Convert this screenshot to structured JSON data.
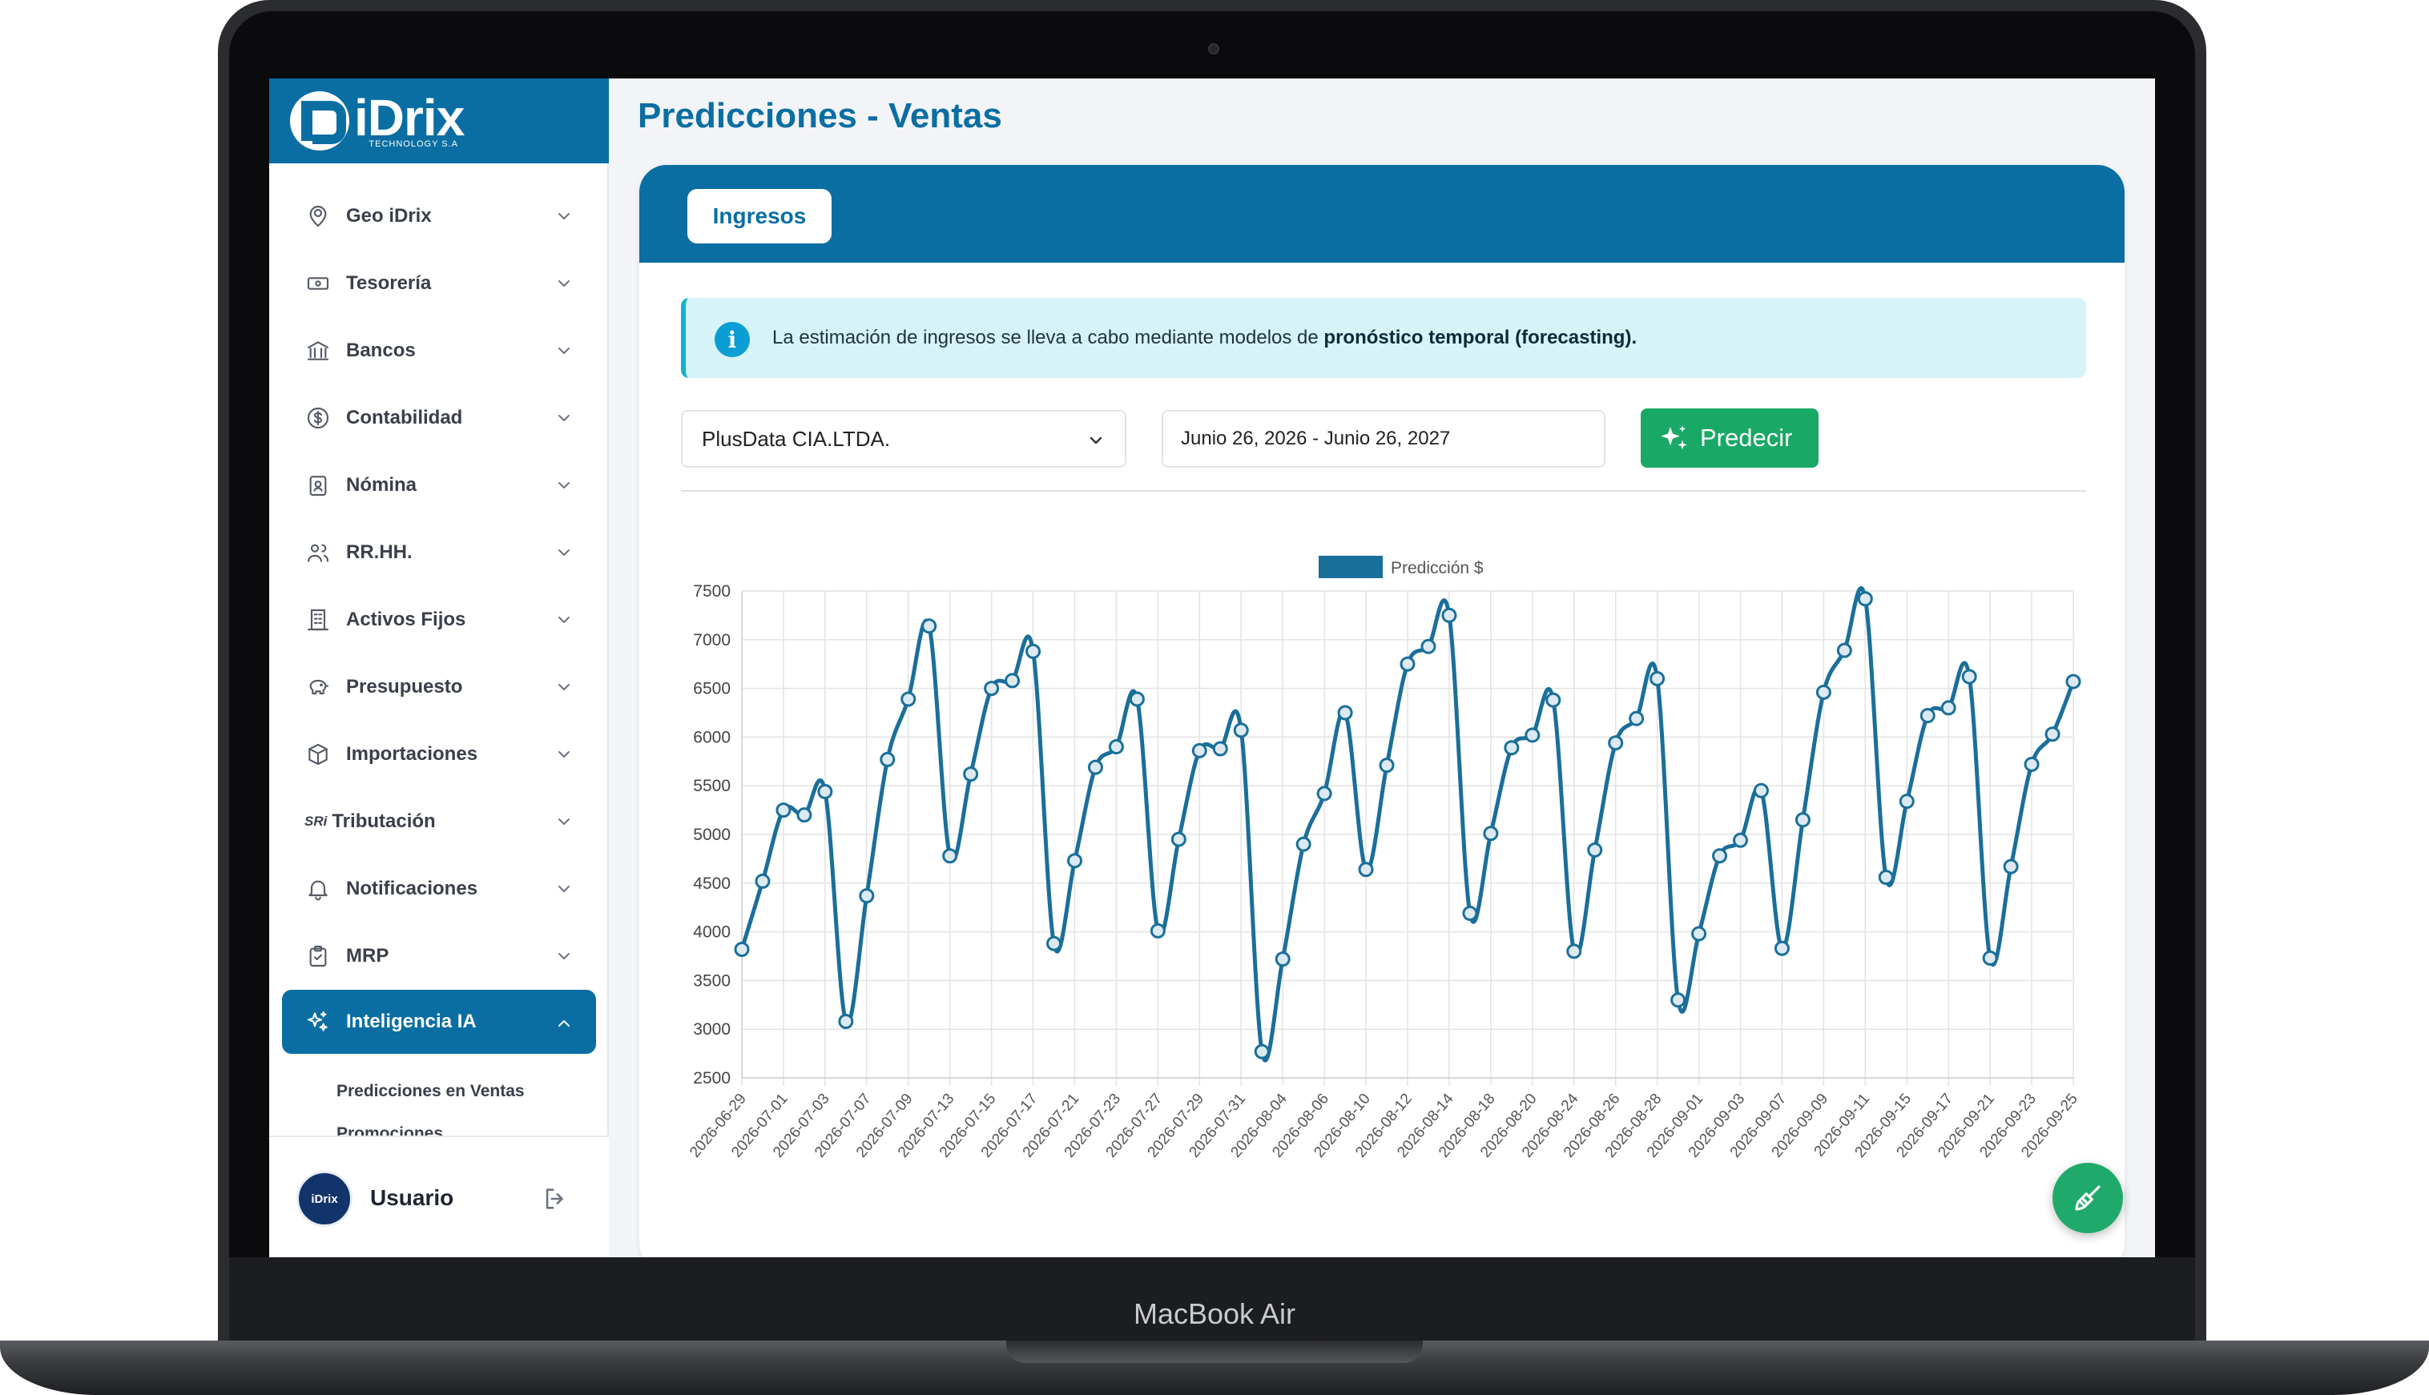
{
  "device": {
    "brand_label": "MacBook Air"
  },
  "brand": {
    "name": "iDrix",
    "subtitle": "TECHNOLOGY S.A"
  },
  "page": {
    "title": "Predicciones - Ventas"
  },
  "sidebar": {
    "items": [
      {
        "label": "Geo iDrix",
        "icon": "location-user-icon"
      },
      {
        "label": "Tesorería",
        "icon": "cash-icon"
      },
      {
        "label": "Bancos",
        "icon": "bank-icon"
      },
      {
        "label": "Contabilidad",
        "icon": "dollar-circle-icon"
      },
      {
        "label": "Nómina",
        "icon": "badge-icon"
      },
      {
        "label": "RR.HH.",
        "icon": "users-icon"
      },
      {
        "label": "Activos Fijos",
        "icon": "building-icon"
      },
      {
        "label": "Presupuesto",
        "icon": "piggy-bank-icon"
      },
      {
        "label": "Importaciones",
        "icon": "box-icon"
      },
      {
        "label": "Tributación",
        "icon": "sri-icon",
        "icon_text": "SRi"
      },
      {
        "label": "Notificaciones",
        "icon": "bell-icon"
      },
      {
        "label": "MRP",
        "icon": "clipboard-icon"
      },
      {
        "label": "Inteligencia IA",
        "icon": "sparkles-icon"
      }
    ],
    "active_submenu": [
      {
        "label": "Predicciones en Ventas"
      },
      {
        "label": "Promociones"
      }
    ],
    "user": {
      "name": "Usuario",
      "avatar_text": "iDrix"
    }
  },
  "tabs": {
    "active": "Ingresos"
  },
  "info": {
    "text": "La estimación de ingresos se lleva a cabo mediante modelos de ",
    "bold": "pronóstico temporal (forecasting)."
  },
  "filters": {
    "company": "PlusData CIA.LTDA.",
    "date_range": "Junio 26, 2026 - Junio 26, 2027",
    "predict_button": "Predecir"
  },
  "colors": {
    "accent": "#0a6ea3",
    "success": "#19a866",
    "info_bg": "#d6f3f8",
    "line": "#1a6f9a"
  },
  "chart_data": {
    "type": "line",
    "legend": "Predicción $",
    "legend_position": "top-center",
    "grid": true,
    "ylim": [
      2500,
      7500
    ],
    "yticks": [
      2500,
      3000,
      3500,
      4000,
      4500,
      5000,
      5500,
      6000,
      6500,
      7000,
      7500
    ],
    "xtick_labels": [
      "2026-06-29",
      "2026-07-01",
      "2026-07-03",
      "2026-07-07",
      "2026-07-09",
      "2026-07-13",
      "2026-07-15",
      "2026-07-17",
      "2026-07-21",
      "2026-07-23",
      "2026-07-27",
      "2026-07-29",
      "2026-07-31",
      "2026-08-04",
      "2026-08-06",
      "2026-08-10",
      "2026-08-12",
      "2026-08-14",
      "2026-08-18",
      "2026-08-20",
      "2026-08-24",
      "2026-08-26",
      "2026-08-28",
      "2026-09-01",
      "2026-09-03",
      "2026-09-07",
      "2026-09-09",
      "2026-09-11",
      "2026-09-15",
      "2026-09-17",
      "2026-09-21",
      "2026-09-23",
      "2026-09-25"
    ],
    "values": [
      3820,
      4520,
      5250,
      5200,
      5440,
      3080,
      4370,
      5770,
      6390,
      7140,
      4780,
      5620,
      6500,
      6580,
      6880,
      3880,
      4730,
      5690,
      5900,
      6390,
      4010,
      4950,
      5860,
      5880,
      6070,
      2770,
      3720,
      4900,
      5420,
      6250,
      4640,
      5710,
      6750,
      6930,
      7250,
      4190,
      5010,
      5890,
      6020,
      6380,
      3800,
      4840,
      5940,
      6190,
      6600,
      3300,
      3980,
      4780,
      4940,
      5450,
      3830,
      5150,
      6460,
      6890,
      7420,
      4560,
      5340,
      6220,
      6300,
      6620,
      3730,
      4670,
      5720,
      6030,
      6570
    ]
  }
}
